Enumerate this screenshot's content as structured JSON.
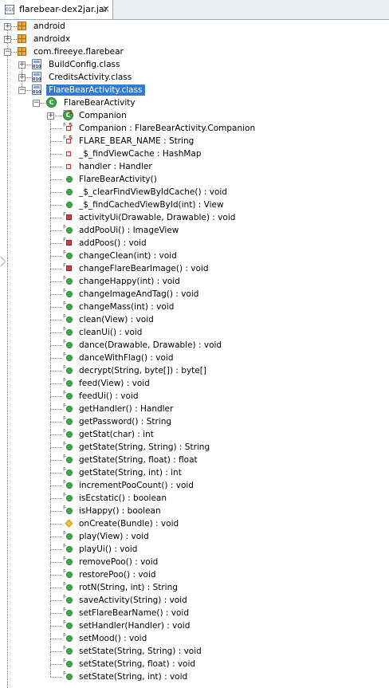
{
  "tab": {
    "title": "flarebear-dex2jar.jar",
    "close_icon": "×",
    "jar_label": "010"
  },
  "tree": [
    {
      "label": "android",
      "icon": "package",
      "level": 0,
      "expander": "plus"
    },
    {
      "label": "androidx",
      "icon": "package",
      "level": 0,
      "expander": "plus"
    },
    {
      "label": "com.fireeye.flarebear",
      "icon": "package",
      "level": 0,
      "expander": "minus"
    },
    {
      "label": "BuildConfig.class",
      "icon": "class-file",
      "level": 1,
      "expander": "plus"
    },
    {
      "label": "CreditsActivity.class",
      "icon": "class-file",
      "level": 1,
      "expander": "plus"
    },
    {
      "label": "FlareBearActivity.class",
      "icon": "class-file",
      "level": 1,
      "expander": "minus",
      "selected": true
    },
    {
      "label": "FlareBearActivity",
      "icon": "class",
      "level": 2,
      "expander": "minus"
    },
    {
      "label": "Companion",
      "icon": "inner-class",
      "level": 3,
      "expander": "plus",
      "mods": "FS"
    },
    {
      "label": "Companion : FlareBearActivity.Companion",
      "icon": "field-private",
      "level": 3,
      "mods": "FS"
    },
    {
      "label": "FLARE_BEAR_NAME : String",
      "icon": "field-private",
      "level": 3,
      "mods": "FS"
    },
    {
      "label": "_$_findViewCache : HashMap",
      "icon": "field-private",
      "level": 3
    },
    {
      "label": "handler : Handler",
      "icon": "field-private",
      "level": 3
    },
    {
      "label": "FlareBearActivity()",
      "icon": "method-public",
      "level": 3
    },
    {
      "label": "_$_clearFindViewByIdCache() : void",
      "icon": "method-public",
      "level": 3
    },
    {
      "label": "_$_findCachedViewById(int) : View",
      "icon": "method-public",
      "level": 3
    },
    {
      "label": "activityUi(Drawable, Drawable) : void",
      "icon": "method-private",
      "level": 3,
      "mods": "F"
    },
    {
      "label": "addPooUi() : ImageView",
      "icon": "method-public",
      "level": 3,
      "mods": "F"
    },
    {
      "label": "addPoos() : void",
      "icon": "method-private",
      "level": 3,
      "mods": "F"
    },
    {
      "label": "changeClean(int) : void",
      "icon": "method-public",
      "level": 3,
      "mods": "F"
    },
    {
      "label": "changeFlareBearImage() : void",
      "icon": "method-private",
      "level": 3,
      "mods": "F"
    },
    {
      "label": "changeHappy(int) : void",
      "icon": "method-public",
      "level": 3,
      "mods": "F"
    },
    {
      "label": "changeImageAndTag() : void",
      "icon": "method-public",
      "level": 3,
      "mods": "F"
    },
    {
      "label": "changeMass(int) : void",
      "icon": "method-public",
      "level": 3,
      "mods": "F"
    },
    {
      "label": "clean(View) : void",
      "icon": "method-public",
      "level": 3,
      "mods": "F"
    },
    {
      "label": "cleanUi() : void",
      "icon": "method-public",
      "level": 3,
      "mods": "F"
    },
    {
      "label": "dance(Drawable, Drawable) : void",
      "icon": "method-public",
      "level": 3,
      "mods": "F"
    },
    {
      "label": "danceWithFlag() : void",
      "icon": "method-public",
      "level": 3,
      "mods": "F"
    },
    {
      "label": "decrypt(String, byte[]) : byte[]",
      "icon": "method-public",
      "level": 3,
      "mods": "F"
    },
    {
      "label": "feed(View) : void",
      "icon": "method-public",
      "level": 3,
      "mods": "F"
    },
    {
      "label": "feedUi() : void",
      "icon": "method-public",
      "level": 3,
      "mods": "F"
    },
    {
      "label": "getHandler() : Handler",
      "icon": "method-public",
      "level": 3,
      "mods": "F"
    },
    {
      "label": "getPassword() : String",
      "icon": "method-public",
      "level": 3,
      "mods": "F"
    },
    {
      "label": "getStat(char) : int",
      "icon": "method-public",
      "level": 3,
      "mods": "F"
    },
    {
      "label": "getState(String, String) : String",
      "icon": "method-public",
      "level": 3,
      "mods": "F"
    },
    {
      "label": "getState(String, float) : float",
      "icon": "method-public",
      "level": 3,
      "mods": "F"
    },
    {
      "label": "getState(String, int) : int",
      "icon": "method-public",
      "level": 3,
      "mods": "F"
    },
    {
      "label": "incrementPooCount() : void",
      "icon": "method-public",
      "level": 3,
      "mods": "F"
    },
    {
      "label": "isEcstatic() : boolean",
      "icon": "method-public",
      "level": 3,
      "mods": "F"
    },
    {
      "label": "isHappy() : boolean",
      "icon": "method-public",
      "level": 3,
      "mods": "F"
    },
    {
      "label": "onCreate(Bundle) : void",
      "icon": "method-protected",
      "level": 3
    },
    {
      "label": "play(View) : void",
      "icon": "method-public",
      "level": 3,
      "mods": "F"
    },
    {
      "label": "playUi() : void",
      "icon": "method-public",
      "level": 3,
      "mods": "F"
    },
    {
      "label": "removePoo() : void",
      "icon": "method-public",
      "level": 3,
      "mods": "F"
    },
    {
      "label": "restorePoo() : void",
      "icon": "method-public",
      "level": 3,
      "mods": "F"
    },
    {
      "label": "rotN(String, int) : String",
      "icon": "method-public",
      "level": 3,
      "mods": "F"
    },
    {
      "label": "saveActivity(String) : void",
      "icon": "method-public",
      "level": 3,
      "mods": "F"
    },
    {
      "label": "setFlareBearName() : void",
      "icon": "method-public",
      "level": 3,
      "mods": "F"
    },
    {
      "label": "setHandler(Handler) : void",
      "icon": "method-public",
      "level": 3,
      "mods": "F"
    },
    {
      "label": "setMood() : void",
      "icon": "method-public",
      "level": 3,
      "mods": "F"
    },
    {
      "label": "setState(String, String) : void",
      "icon": "method-public",
      "level": 3,
      "mods": "F"
    },
    {
      "label": "setState(String, float) : void",
      "icon": "method-public",
      "level": 3,
      "mods": "F"
    },
    {
      "label": "setState(String, int) : void",
      "icon": "method-public",
      "level": 3,
      "mods": "F"
    }
  ],
  "colors": {
    "selection": "#2e7cd6",
    "method_public": "#46a84d",
    "method_private": "#d63a3a",
    "package": "#e8a849"
  }
}
